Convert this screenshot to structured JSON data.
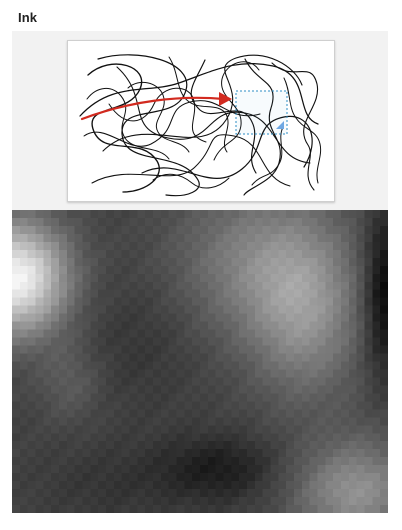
{
  "header": {
    "title": "Ink"
  },
  "ink_preview": {
    "stroke_color": "#111111",
    "arrow_color": "#d22a1f",
    "selection_color": "#2c8ec4",
    "selection_handle_color": "#6ea8e3"
  },
  "heatmap": {
    "dark_color": "#050505",
    "light_color": "#f4f4f4"
  }
}
